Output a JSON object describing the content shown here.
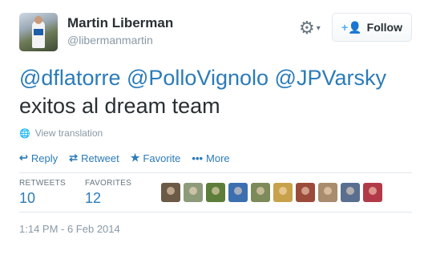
{
  "header": {
    "name": "Martin Liberman",
    "handle": "@libermanmartin",
    "follow_icon": "+👤",
    "follow_label": "Follow",
    "gear_icon": "⚙",
    "caret_icon": "▾"
  },
  "tweet": {
    "mention1": "@dflatorre",
    "mention2": "@PolloVignolo",
    "mention3": "@JPVarsky",
    "text": " exitos al dream team"
  },
  "translate": {
    "icon": "🌐",
    "label": "View translation"
  },
  "actions": {
    "reply": {
      "icon": "↩",
      "label": "Reply"
    },
    "retweet": {
      "icon": "⇄",
      "label": "Retweet"
    },
    "favorite": {
      "icon": "★",
      "label": "Favorite"
    },
    "more": {
      "icon": "•••",
      "label": "More"
    }
  },
  "stats": {
    "retweets_label": "RETWEETS",
    "retweets": "10",
    "favorites_label": "FAVORITES",
    "favorites": "12"
  },
  "faces": [
    {
      "color": "#6b5a45"
    },
    {
      "color": "#8e9b7a"
    },
    {
      "color": "#5d7d3a"
    },
    {
      "color": "#3c6fb0"
    },
    {
      "color": "#7d8a5a"
    },
    {
      "color": "#c7a24a"
    },
    {
      "color": "#9b4b3a"
    },
    {
      "color": "#a88c6d"
    },
    {
      "color": "#5a6f8f"
    },
    {
      "color": "#b23a48"
    }
  ],
  "timestamp": "1:14 PM - 6 Feb 2014",
  "colors": {
    "link": "#2b7bb9",
    "muted": "#8899a6",
    "follow_icon": "#55acee"
  }
}
